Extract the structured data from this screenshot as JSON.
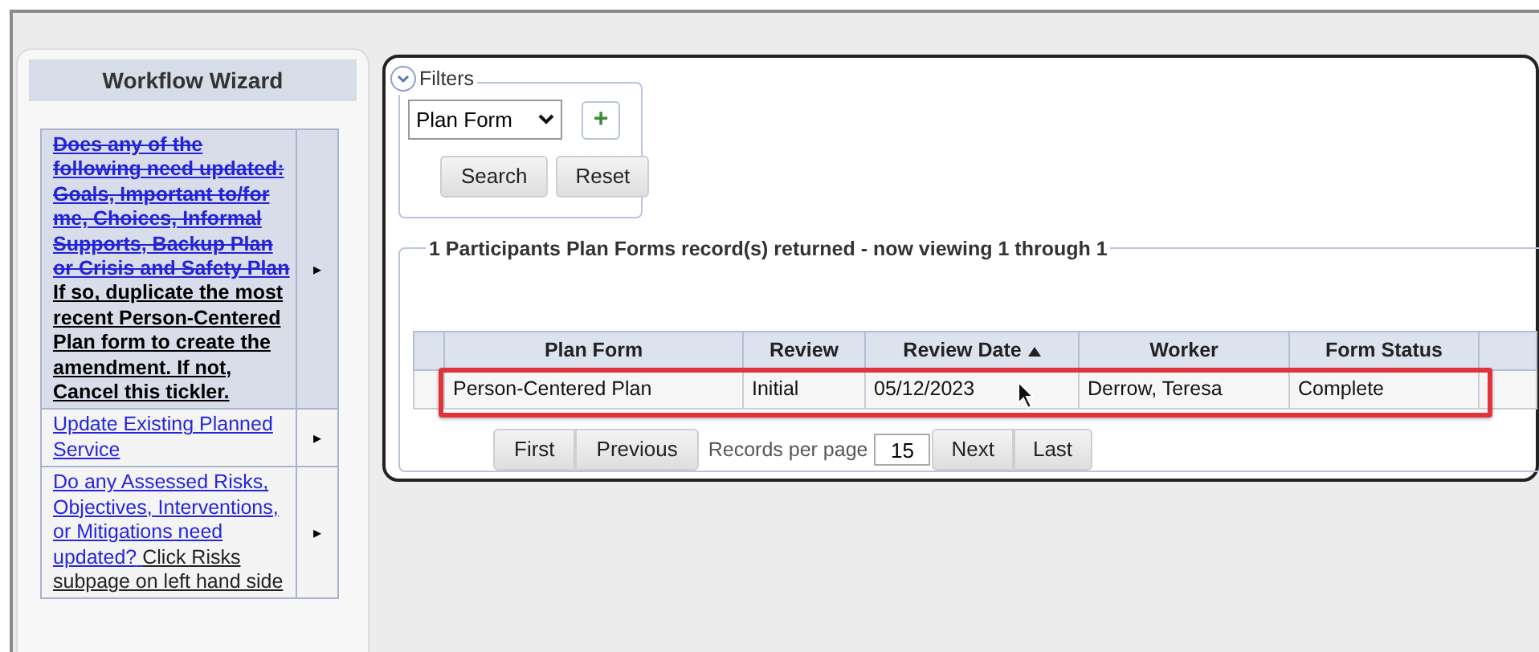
{
  "wizard": {
    "title": "Workflow Wizard",
    "items": [
      {
        "selected": true,
        "segments": [
          {
            "kind": "struck",
            "text": "Does any of the following need updated: Goals, Important to/for me, Choices, Informal Supports, Backup Plan or Crisis and Safety Plan"
          },
          {
            "kind": "note-bold",
            "text": "If so, duplicate the most recent Person-Centered Plan form to create the amendment. If not, Cancel this tickler."
          }
        ],
        "arrow": "▸"
      },
      {
        "selected": false,
        "segments": [
          {
            "kind": "link",
            "text": "Update Existing Planned Service"
          }
        ],
        "arrow": "▸"
      },
      {
        "selected": false,
        "segments": [
          {
            "kind": "link",
            "text": "Do any Assessed Risks, Objectives, Interventions, or Mitigations need updated?"
          },
          {
            "kind": "note",
            "text": "Click Risks subpage on left hand side"
          }
        ],
        "arrow": "▸"
      }
    ]
  },
  "filters": {
    "legend": "Filters",
    "expanded": true,
    "select_value": "Plan Form",
    "add": "+",
    "search": "Search",
    "reset": "Reset"
  },
  "results": {
    "legend": "1 Participants Plan Forms record(s) returned - now viewing 1 through 1",
    "columns": [
      {
        "label": "Plan Form",
        "sorted": false
      },
      {
        "label": "Review",
        "sorted": false
      },
      {
        "label": "Review Date",
        "sorted": true
      },
      {
        "label": "Worker",
        "sorted": false
      },
      {
        "label": "Form Status",
        "sorted": false
      }
    ],
    "rows": [
      {
        "highlighted": true,
        "cells": [
          "Person-Centered Plan",
          "Initial",
          "05/12/2023",
          "Derrow, Teresa",
          "Complete"
        ]
      }
    ],
    "pager": {
      "first": "First",
      "previous": "Previous",
      "per_page_label": "Records per page",
      "per_page": "15",
      "next": "Next",
      "last": "Last"
    }
  }
}
